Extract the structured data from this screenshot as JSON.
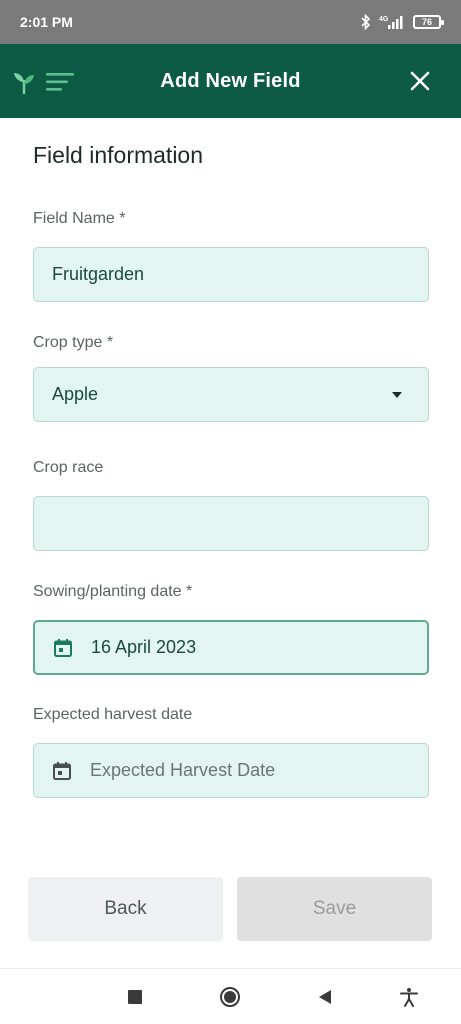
{
  "status_bar": {
    "time": "2:01 PM",
    "network": "4G",
    "battery": "76"
  },
  "header": {
    "title": "Add New Field",
    "logo_icon": "sprout-menu-icon",
    "close_icon": "close-icon"
  },
  "form": {
    "section_title": "Field information",
    "field_name": {
      "label": "Field Name *",
      "value": "Fruitgarden"
    },
    "crop_type": {
      "label": "Crop type *",
      "value": "Apple"
    },
    "crop_race": {
      "label": "Crop race",
      "value": ""
    },
    "sowing_date": {
      "label": "Sowing/planting date *",
      "value": "16 April 2023"
    },
    "harvest_date": {
      "label": "Expected harvest date",
      "placeholder": "Expected Harvest Date"
    }
  },
  "buttons": {
    "back": "Back",
    "save": "Save"
  },
  "colors": {
    "header_bg": "#0d5a45",
    "field_bg": "#e2f5f0",
    "accent": "#1c7a5e"
  },
  "nav": {
    "items": [
      "recent-apps-icon",
      "home-icon",
      "back-icon",
      "accessibility-icon"
    ]
  }
}
